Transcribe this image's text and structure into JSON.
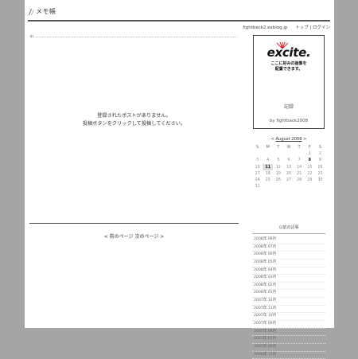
{
  "header": {
    "site_title": "メモ帳"
  },
  "topbar": {
    "domain": "fightback2.exblog.jp",
    "top_link": "トップ",
    "separator": "|",
    "login_link": "ログイン"
  },
  "main": {
    "empty_line1": "登録されたポストがありません。",
    "empty_line2": "投稿ボタンをクリックして投稿してください。",
    "pager": "< 前のページ 次のページ >"
  },
  "sidebar": {
    "ad": {
      "logo": "excite.",
      "line1": "ここに好みの画像を",
      "line2": "配置できます。",
      "record": "記録",
      "by": "by fightback2008"
    },
    "calendar": {
      "prev": "<",
      "month": "August 2008",
      "next": ">",
      "weekdays": [
        "S",
        "M",
        "T",
        "W",
        "T",
        "F",
        "S"
      ],
      "weeks": [
        [
          "",
          "",
          "",
          "",
          "",
          "1",
          "2"
        ],
        [
          "3",
          "4",
          "5",
          "6",
          "7",
          "8",
          "9"
        ],
        [
          "10",
          "11",
          "12",
          "13",
          "14",
          "15",
          "16"
        ],
        [
          "17",
          "18",
          "19",
          "20",
          "21",
          "22",
          "23"
        ],
        [
          "24",
          "25",
          "26",
          "27",
          "28",
          "29",
          "30"
        ],
        [
          "31",
          "",
          "",
          "",
          "",
          "",
          ""
        ]
      ]
    },
    "archive": {
      "title": "以前の記事",
      "items": [
        "2008年 08月",
        "2008年 07月",
        "2008年 06月",
        "2008年 05月",
        "2008年 04月",
        "2008年 03月",
        "2008年 02月",
        "2008年 01月",
        "2007年 12月",
        "2007年 11月",
        "2007年 10月",
        "2007年 09月",
        "2007年 08月",
        "2007年 07月",
        "2007年 06月",
        "2006年 12月"
      ]
    }
  }
}
